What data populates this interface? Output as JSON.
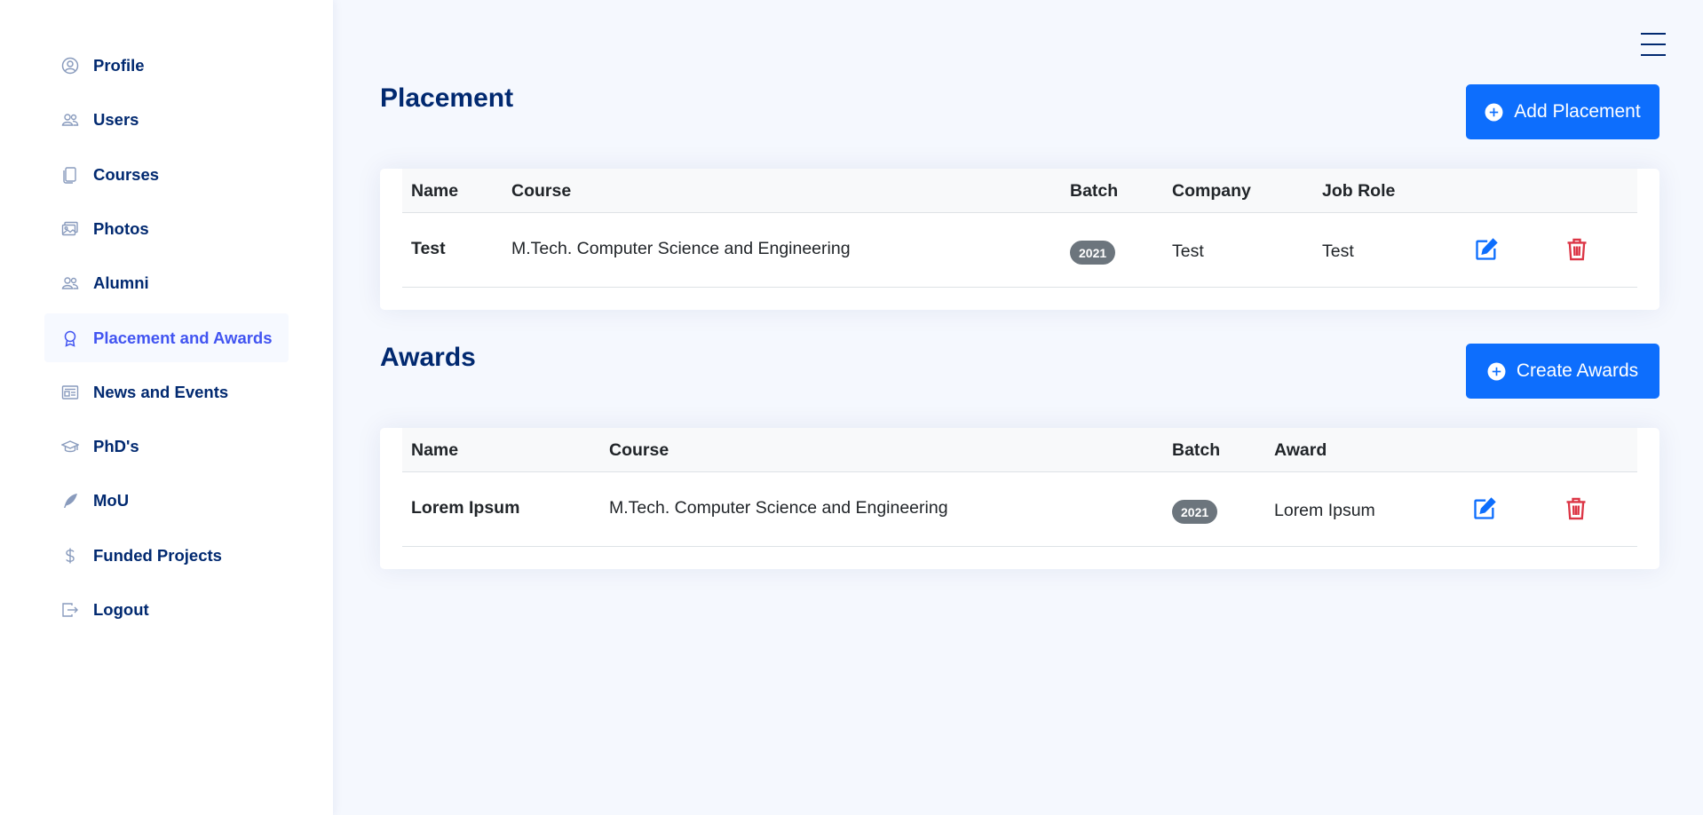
{
  "sidebar": {
    "items": [
      {
        "label": "Profile",
        "icon": "person-circle-icon"
      },
      {
        "label": "Users",
        "icon": "people-icon"
      },
      {
        "label": "Courses",
        "icon": "journals-icon"
      },
      {
        "label": "Photos",
        "icon": "images-icon"
      },
      {
        "label": "Alumni",
        "icon": "people-icon"
      },
      {
        "label": "Placement and Awards",
        "icon": "award-icon",
        "active": true
      },
      {
        "label": "News and Events",
        "icon": "newspaper-icon"
      },
      {
        "label": "PhD's",
        "icon": "mortarboard-icon"
      },
      {
        "label": "MoU",
        "icon": "feather-icon"
      },
      {
        "label": "Funded Projects",
        "icon": "dollar-icon"
      },
      {
        "label": "Logout",
        "icon": "box-arrow-right-icon"
      }
    ]
  },
  "header": {
    "menu_icon": "hamburger-menu-icon"
  },
  "placement": {
    "title": "Placement",
    "add_button": "Add Placement",
    "columns": [
      "Name",
      "Course",
      "Batch",
      "Company",
      "Job Role"
    ],
    "rows": [
      {
        "name": "Test",
        "course": "M.Tech. Computer Science and Engineering",
        "batch": "2021",
        "company": "Test",
        "job_role": "Test"
      }
    ]
  },
  "awards": {
    "title": "Awards",
    "create_button": "Create Awards",
    "columns": [
      "Name",
      "Course",
      "Batch",
      "Award"
    ],
    "rows": [
      {
        "name": "Lorem Ipsum",
        "course": "M.Tech. Computer Science and Engineering",
        "batch": "2021",
        "award": "Lorem Ipsum"
      }
    ]
  },
  "colors": {
    "primary": "#0d6efd",
    "nav_text": "#012970",
    "nav_active": "#4154f1",
    "delete": "#dc3545",
    "badge": "#6c757d",
    "page_bg": "#f5f8fe"
  }
}
